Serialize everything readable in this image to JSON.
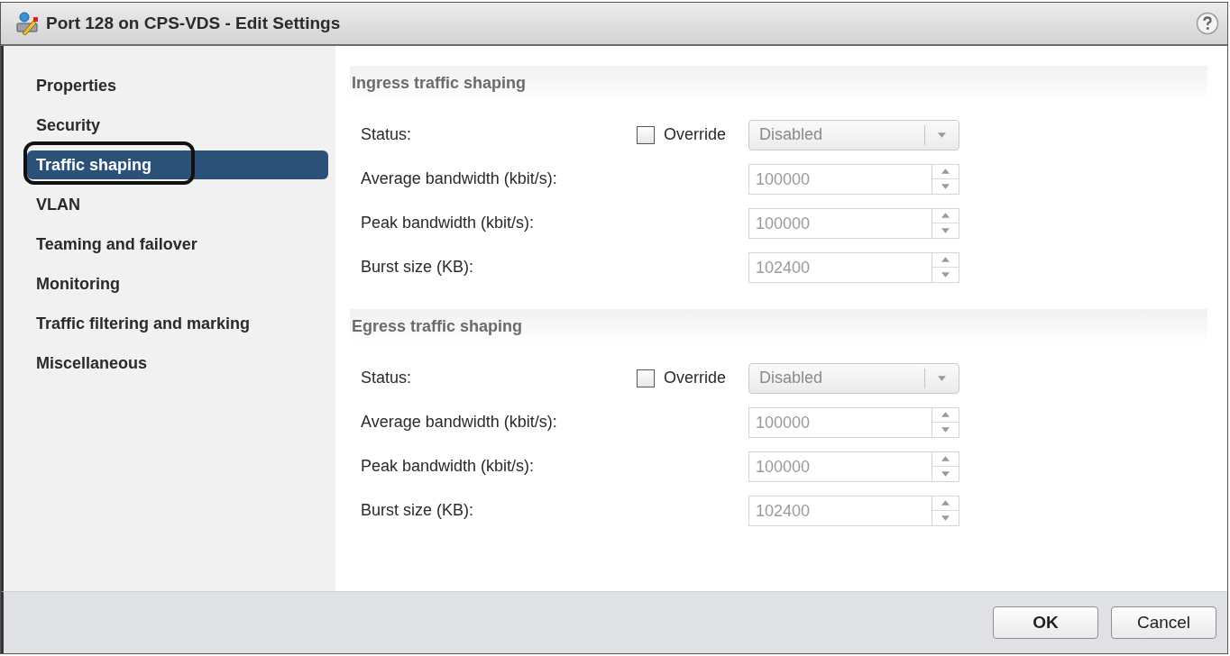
{
  "window": {
    "title": "Port 128 on CPS-VDS - Edit Settings"
  },
  "sidebar": {
    "items": [
      {
        "label": "Properties",
        "selected": false,
        "annotated": false
      },
      {
        "label": "Security",
        "selected": false,
        "annotated": false
      },
      {
        "label": "Traffic shaping",
        "selected": true,
        "annotated": true
      },
      {
        "label": "VLAN",
        "selected": false,
        "annotated": false
      },
      {
        "label": "Teaming and failover",
        "selected": false,
        "annotated": false
      },
      {
        "label": "Monitoring",
        "selected": false,
        "annotated": false
      },
      {
        "label": "Traffic filtering and marking",
        "selected": false,
        "annotated": false
      },
      {
        "label": "Miscellaneous",
        "selected": false,
        "annotated": false
      }
    ]
  },
  "sections": [
    {
      "title": "Ingress traffic shaping",
      "rows": [
        {
          "kind": "status",
          "label": "Status:",
          "override": {
            "label": "Override",
            "checked": false
          },
          "select": {
            "value": "Disabled",
            "disabled": true
          }
        },
        {
          "kind": "number",
          "label": "Average bandwidth (kbit/s):",
          "value": "100000",
          "disabled": true
        },
        {
          "kind": "number",
          "label": "Peak bandwidth (kbit/s):",
          "value": "100000",
          "disabled": true
        },
        {
          "kind": "number",
          "label": "Burst size (KB):",
          "value": "102400",
          "disabled": true
        }
      ]
    },
    {
      "title": "Egress traffic shaping",
      "rows": [
        {
          "kind": "status",
          "label": "Status:",
          "override": {
            "label": "Override",
            "checked": false
          },
          "select": {
            "value": "Disabled",
            "disabled": true
          }
        },
        {
          "kind": "number",
          "label": "Average bandwidth (kbit/s):",
          "value": "100000",
          "disabled": true
        },
        {
          "kind": "number",
          "label": "Peak bandwidth (kbit/s):",
          "value": "100000",
          "disabled": true
        },
        {
          "kind": "number",
          "label": "Burst size (KB):",
          "value": "102400",
          "disabled": true
        }
      ]
    }
  ],
  "buttons": [
    {
      "label": "OK"
    },
    {
      "label": "Cancel"
    }
  ]
}
